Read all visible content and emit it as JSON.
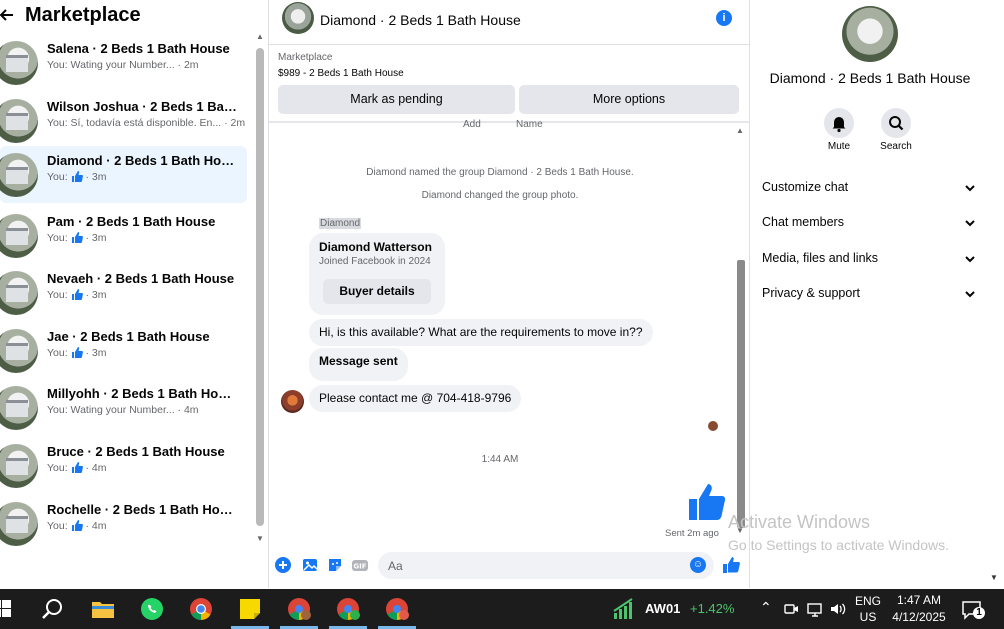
{
  "left": {
    "title": "Marketplace",
    "conversations": [
      {
        "name": "Salena · 2 Beds 1 Bath House",
        "preview": "You: Wating your Number... · 2m"
      },
      {
        "name": "Wilson Joshua · 2 Beds 1 Bath H...",
        "preview": "You: Sí, todavía está disponible. En... · 2m"
      },
      {
        "name": "Diamond · 2 Beds 1 Bath House",
        "preview_prefix": "You:",
        "preview_suffix": "· 3m"
      },
      {
        "name": "Pam · 2 Beds 1 Bath House",
        "preview_prefix": "You:",
        "preview_suffix": "· 3m"
      },
      {
        "name": "Nevaeh · 2 Beds 1 Bath House",
        "preview_prefix": "You:",
        "preview_suffix": "· 3m"
      },
      {
        "name": "Jae · 2 Beds 1 Bath House",
        "preview_prefix": "You:",
        "preview_suffix": "· 3m"
      },
      {
        "name": "Millyohh · 2 Beds 1 Bath House",
        "preview": "You: Wating your Number... · 4m"
      },
      {
        "name": "Bruce · 2 Beds 1 Bath House",
        "preview_prefix": "You:",
        "preview_suffix": "· 4m"
      },
      {
        "name": "Rochelle · 2 Beds 1 Bath House",
        "preview_prefix": "You:",
        "preview_suffix": "· 4m"
      }
    ]
  },
  "chat": {
    "title": "Diamond · 2 Beds 1 Bath House",
    "marketplace_label": "Marketplace",
    "listing": "$989 - 2 Beds 1 Bath House",
    "mark_pending": "Mark as pending",
    "more_options": "More options",
    "cut_add": "Add",
    "cut_name": "Name",
    "system1": "Diamond named the group Diamond · 2 Beds 1 Bath House.",
    "system2": "Diamond changed the group photo.",
    "sender_label": "Diamond",
    "card_name": "Diamond Watterson",
    "card_sub": "Joined Facebook in 2024",
    "card_button": "Buyer details",
    "msg1": "Hi, is this available? What are the requirements to move in??",
    "msg2": "Message sent",
    "msg3": "Please contact me @ 704-418-9796",
    "time": "1:44 AM",
    "sent": "Sent 2m ago",
    "composer_placeholder": "Aa",
    "accent": "#1877f2"
  },
  "right": {
    "title": "Diamond · 2 Beds 1 Bath House",
    "mute": "Mute",
    "search": "Search",
    "sections": [
      "Customize chat",
      "Chat members",
      "Media, files and links",
      "Privacy & support"
    ]
  },
  "watermark": {
    "line1": "Activate Windows",
    "line2": "Go to Settings to activate Windows."
  },
  "taskbar": {
    "stock_name": "AW01",
    "stock_change": "+1.42%",
    "lang1": "ENG",
    "lang2": "US",
    "time": "1:47 AM",
    "date": "4/12/2025",
    "notif_count": "1"
  }
}
